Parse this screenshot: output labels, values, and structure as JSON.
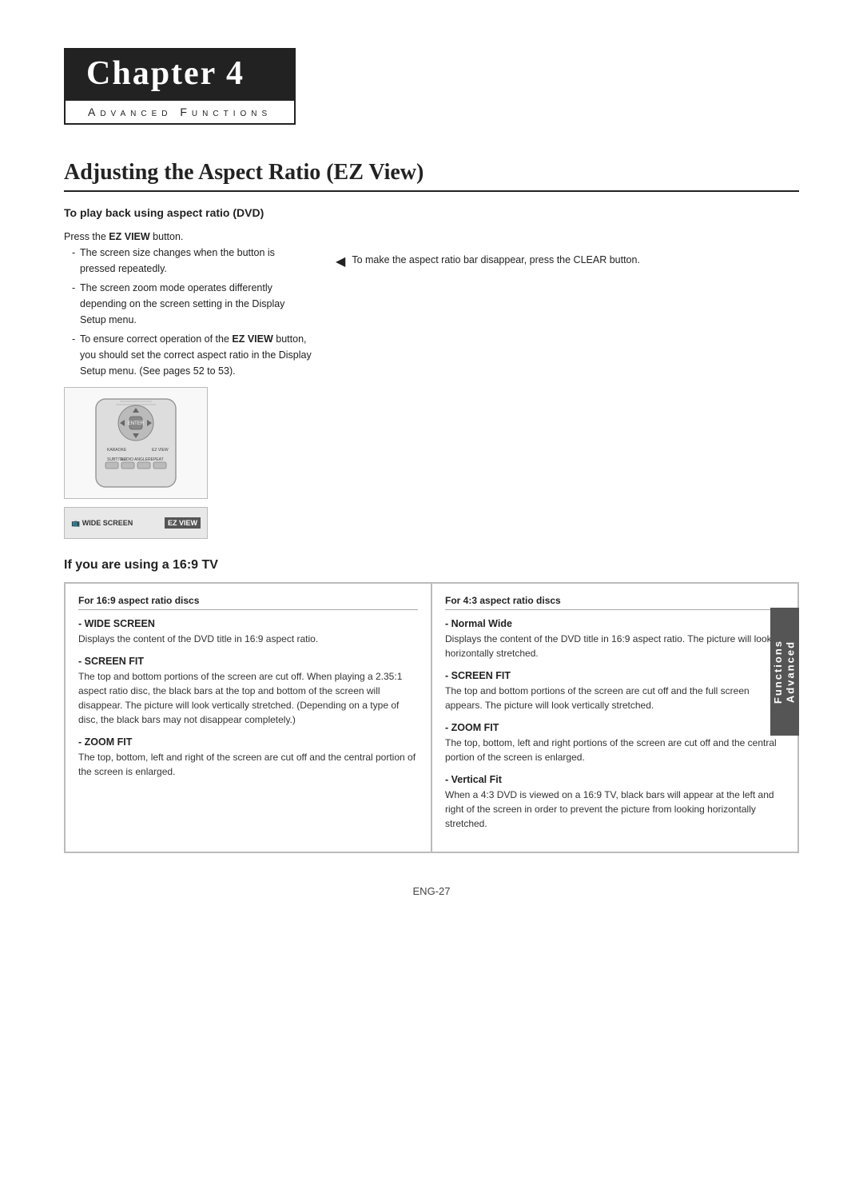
{
  "chapter": {
    "label": "Chapter 4",
    "subtitle": "Advanced Functions"
  },
  "page_title": "Adjusting the Aspect Ratio (EZ View)",
  "section1": {
    "heading": "To play back using aspect ratio (DVD)",
    "instruction_intro": "Press the EZ VIEW button.",
    "bullets": [
      "The screen size changes when the button is pressed repeatedly.",
      "The screen zoom mode operates differently depending on the screen setting in the Display Setup menu.",
      "To ensure correct operation of the EZ VIEW button, you should set the correct aspect ratio in the Display Setup menu. (See pages 52 to 53)."
    ],
    "tip": "To make the aspect ratio bar disappear, press the CLEAR button."
  },
  "section2": {
    "heading": "If you are using a 16:9 TV",
    "col1_header": "For 16:9 aspect ratio discs",
    "col2_header": "For 4:3 aspect ratio discs",
    "col1_modes": [
      {
        "title": "WIDE SCREEN",
        "desc": "Displays the content of the DVD title in 16:9 aspect ratio."
      },
      {
        "title": "SCREEN FIT",
        "desc": "The top and bottom portions of the screen are cut off. When playing a 2.35:1 aspect ratio disc, the black bars at the top and bottom of the screen will disappear. The picture will look vertically stretched. (Depending on a type of disc, the black bars may not disappear completely.)"
      },
      {
        "title": "ZOOM FIT",
        "desc": "The top, bottom, left and right of the screen are cut off and the central portion of the screen is enlarged."
      }
    ],
    "col2_modes": [
      {
        "title": "Normal Wide",
        "desc": "Displays the content of the DVD title in 16:9 aspect ratio. The picture will look horizontally stretched."
      },
      {
        "title": "SCREEN FIT",
        "desc": "The top and bottom portions of the screen are cut off and the full screen appears. The picture will look vertically stretched."
      },
      {
        "title": "ZOOM FIT",
        "desc": "The top, bottom, left and right portions of the screen are cut off and the central portion of the screen is enlarged."
      },
      {
        "title": "Vertical Fit",
        "desc": "When a 4:3 DVD is viewed on a 16:9 TV, black bars will appear at the left and right of the screen in order to prevent the picture from looking horizontally stretched."
      }
    ]
  },
  "side_tab": {
    "line1": "Advanced",
    "line2": "Functions"
  },
  "page_number": "ENG-27"
}
